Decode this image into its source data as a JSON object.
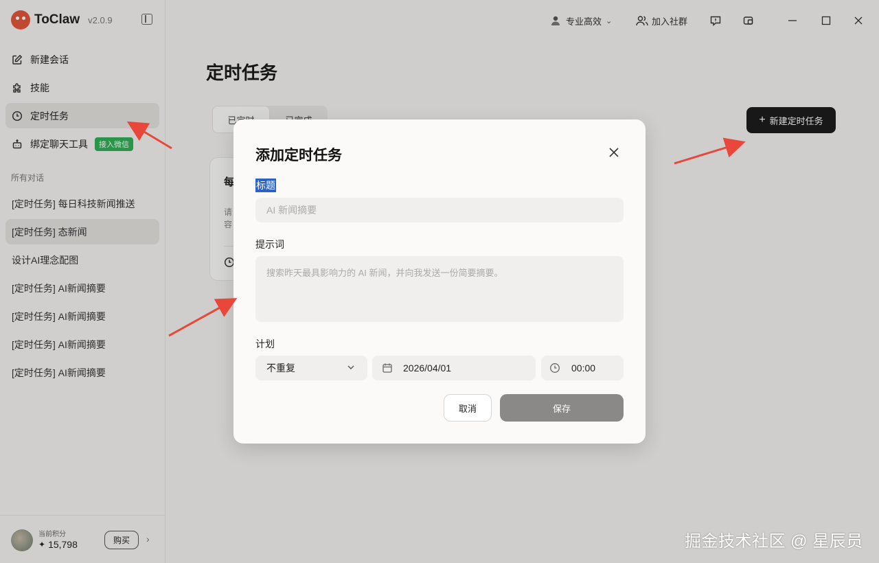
{
  "app": {
    "name": "ToClaw",
    "version": "v2.0.9"
  },
  "sidebar": {
    "nav": [
      {
        "label": "新建会话",
        "icon": "edit-icon"
      },
      {
        "label": "技能",
        "icon": "puzzle-icon"
      },
      {
        "label": "定时任务",
        "icon": "clock-icon",
        "active": true
      },
      {
        "label": "绑定聊天工具",
        "icon": "robot-icon",
        "badge": "接入微信"
      }
    ],
    "section_title": "所有对话",
    "conversations": [
      "[定时任务] 每日科技新闻推送",
      "[定时任务]  态新闻",
      "设计AI理念配图",
      "[定时任务] AI新闻摘要",
      "[定时任务] AI新闻摘要",
      "[定时任务] AI新闻摘要",
      "[定时任务] AI新闻摘要"
    ],
    "footer": {
      "credit_label": "当前积分",
      "credit_value": "15,798",
      "buy_label": "购买"
    }
  },
  "header": {
    "mode_label": "专业高效",
    "community_label": "加入社群"
  },
  "main": {
    "title": "定时任务",
    "tabs": [
      "已定时",
      "已完成"
    ],
    "new_task_label": "新建定时任务",
    "card": {
      "title_fragment": "每",
      "desc_fragment_1": "请",
      "desc_fragment_2": "容"
    }
  },
  "modal": {
    "title": "添加定时任务",
    "title_label": "标题",
    "title_placeholder": "AI 新闻摘要",
    "prompt_label": "提示词",
    "prompt_placeholder": "搜索昨天最具影响力的 AI 新闻，并向我发送一份简要摘要。",
    "plan_label": "计划",
    "repeat_value": "不重复",
    "date_value": "2026/04/01",
    "time_value": "00:00",
    "cancel_label": "取消",
    "save_label": "保存"
  },
  "watermark": "掘金技术社区 @ 星辰员"
}
